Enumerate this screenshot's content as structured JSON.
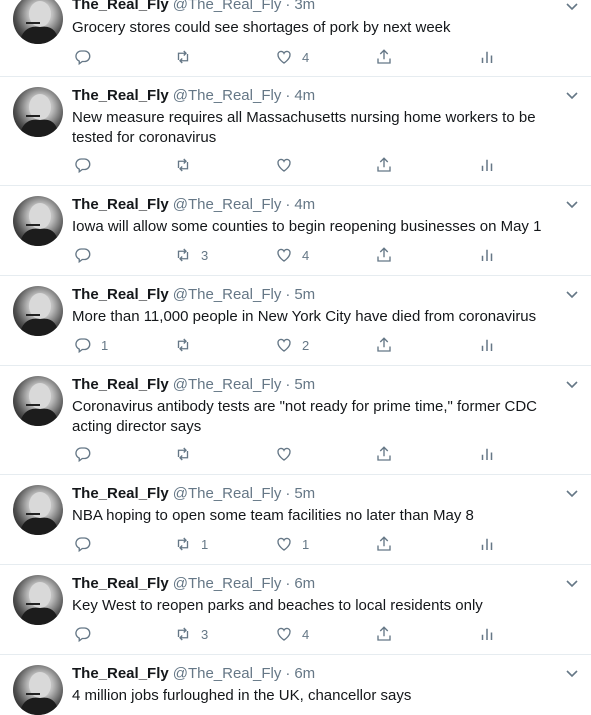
{
  "colors": {
    "text": "#14171a",
    "secondary": "#657786",
    "divider": "#e6ecf0"
  },
  "icons": {
    "reply": "reply-icon",
    "retweet": "retweet-icon",
    "like": "heart-icon",
    "share": "share-icon",
    "stats": "analytics-icon",
    "menu": "chevron-down-icon"
  },
  "tweets": [
    {
      "name": "The_Real_Fly",
      "handle": "@The_Real_Fly",
      "sep": "·",
      "time": "3m",
      "text": "Grocery stores could see shortages of pork by next week",
      "replies": "",
      "retweets": "",
      "likes": "4"
    },
    {
      "name": "The_Real_Fly",
      "handle": "@The_Real_Fly",
      "sep": "·",
      "time": "4m",
      "text": "New measure requires all Massachusetts nursing home workers to be tested for coronavirus",
      "replies": "",
      "retweets": "",
      "likes": ""
    },
    {
      "name": "The_Real_Fly",
      "handle": "@The_Real_Fly",
      "sep": "·",
      "time": "4m",
      "text": "Iowa will allow some counties to begin reopening businesses on May 1",
      "replies": "",
      "retweets": "3",
      "likes": "4"
    },
    {
      "name": "The_Real_Fly",
      "handle": "@The_Real_Fly",
      "sep": "·",
      "time": "5m",
      "text": "More than 11,000 people in New York City have died from coronavirus",
      "replies": "1",
      "retweets": "",
      "likes": "2"
    },
    {
      "name": "The_Real_Fly",
      "handle": "@The_Real_Fly",
      "sep": "·",
      "time": "5m",
      "text": "Coronavirus antibody tests are \"not ready for prime time,\" former CDC acting director says",
      "replies": "",
      "retweets": "",
      "likes": ""
    },
    {
      "name": "The_Real_Fly",
      "handle": "@The_Real_Fly",
      "sep": "·",
      "time": "5m",
      "text": "NBA hoping to open some team facilities no later than May 8",
      "replies": "",
      "retweets": "1",
      "likes": "1"
    },
    {
      "name": "The_Real_Fly",
      "handle": "@The_Real_Fly",
      "sep": "·",
      "time": "6m",
      "text": "Key West to reopen parks and beaches to local residents only",
      "replies": "",
      "retweets": "3",
      "likes": "4"
    },
    {
      "name": "The_Real_Fly",
      "handle": "@The_Real_Fly",
      "sep": "·",
      "time": "6m",
      "text": "4 million jobs furloughed in the UK, chancellor says",
      "replies": "",
      "retweets": "",
      "likes": ""
    }
  ]
}
